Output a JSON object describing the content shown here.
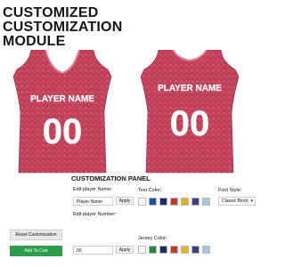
{
  "headline": [
    "CUSTOMIZED",
    "CUSTOMIZATION",
    "MODULE"
  ],
  "jersey_left": {
    "name": "PLAYER NAME",
    "number": "00",
    "color": "#c8475f"
  },
  "jersey_right": {
    "name": "PLAYER NAME",
    "number": "00",
    "color": "#c8475f"
  },
  "panel": {
    "title": "CUSTOMIZATION PANEL",
    "player_name_label": "Edit player Name:",
    "player_name_value": "Player Name",
    "player_number_label": "Edit player Number:",
    "player_number_value": "00",
    "apply_label": "Apply",
    "text_color_label": "Text Color:",
    "jersey_color_label": "Jersey Color:",
    "font_style_label": "Font Style:",
    "font_style_value": "Classic Block",
    "text_colors": [
      "#ffffff",
      "#1f4f9a",
      "#1f2a6b",
      "#c0392b",
      "#e5b11f",
      "#3d3d8a",
      "#a5c6e8"
    ],
    "jersey_colors": [
      "#ffffff",
      "#1e8a3c",
      "#1f2a6b",
      "#c0392b",
      "#e5b11f",
      "#3d3d8a",
      "#a5c6e8"
    ]
  },
  "buttons": {
    "reset_label": "Reset Customization",
    "cart_label": "Add To Cart",
    "cart_color": "#2d9c4b"
  }
}
